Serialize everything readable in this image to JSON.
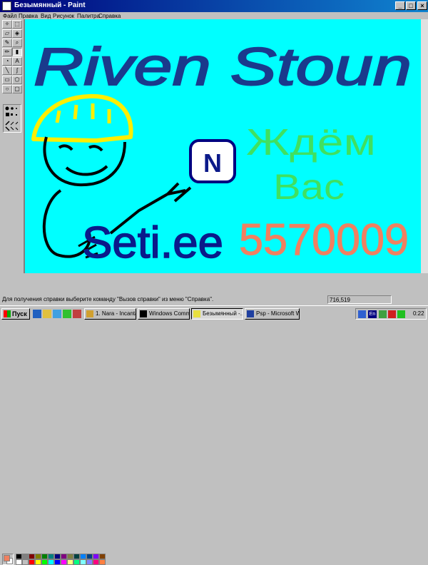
{
  "window": {
    "title": "Безымянный - Paint"
  },
  "menu": [
    "Файл",
    "Правка",
    "Вид",
    "Рисунок",
    "Палитра",
    "Справка"
  ],
  "toolbox": {
    "tools": [
      "free-select",
      "rect-select",
      "eraser",
      "fill",
      "color-picker",
      "magnifier",
      "pencil",
      "brush",
      "airbrush",
      "text",
      "line",
      "curve",
      "rectangle",
      "polygon",
      "ellipse",
      "rounded-rect"
    ],
    "active_tool": "brush"
  },
  "drawing": {
    "title_text": "Riven Stoun",
    "brand_text": "Seti.ee",
    "badge_letter": "N",
    "russian_line1": "Ждём",
    "russian_line2": "Вас",
    "phone": "5570009",
    "colors": {
      "background": "#00ffff",
      "title": "#1a3a8c",
      "outline": "#000000",
      "helmet": "#ffee00",
      "brand": "#0b1a8a",
      "russian": "#40e060",
      "phone": "#f08060"
    }
  },
  "palette": {
    "primary": "#000000",
    "secondary": "#ffffff",
    "top_row": [
      "#000000",
      "#808080",
      "#800000",
      "#808000",
      "#008000",
      "#008080",
      "#000080",
      "#800080",
      "#808040",
      "#004040",
      "#0080ff",
      "#004080",
      "#8000ff",
      "#804000"
    ],
    "bottom_row": [
      "#ffffff",
      "#c0c0c0",
      "#ff0000",
      "#ffff00",
      "#00ff00",
      "#00ffff",
      "#0000ff",
      "#ff00ff",
      "#ffff80",
      "#00ff80",
      "#80ffff",
      "#8080ff",
      "#ff0080",
      "#ff8040"
    ]
  },
  "status": {
    "message": "Для получения справки выберите команду \"Вызов справки\" из меню \"Справка\".",
    "coords": "716,519"
  },
  "taskbar": {
    "start_label": "Пуск",
    "tasks": [
      "1. Nara - Incantat...",
      "Windows Comma...",
      "Безымянный -...",
      "Psp - Microsoft W..."
    ],
    "active_task": 2,
    "lang": "En",
    "clock": "0:22"
  }
}
